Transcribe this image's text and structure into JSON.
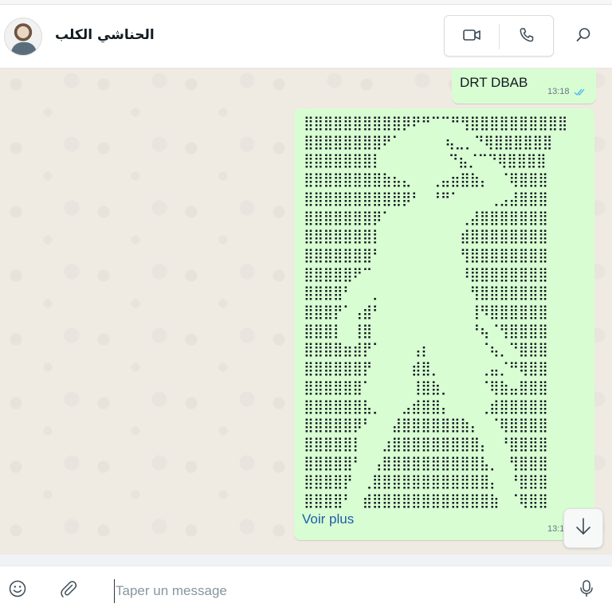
{
  "header": {
    "contact_name": "الحناشي الكلب",
    "video_call_icon": "video-camera-icon",
    "voice_call_icon": "phone-icon",
    "search_icon": "search-icon"
  },
  "messages": [
    {
      "text": "DRT DBAB",
      "time": "13:18",
      "status_icon": "double-check-read-icon"
    },
    {
      "ascii_art": "⣿⣿⣿⣿⣿⣿⣿⣿⣿⣿⡿⠟⠛⠉⠉⠛⢻⣿⣿⣿⣿⣿⣿⣿⣿⣿⣿\n⣿⣿⣿⣿⣿⣿⣿⣿⠟⠁  ⠀⠀ ⢦⣀⡀⠙⢿⣿⣿⣿⣿⣿⣿\n⣿⣿⣿⣿⣿⣿⣿⡇⠀⠀⠀⠀⠀ ⠀⠙⣦⡈⠉⠙⢿⣿⣿⣿⣿\n⣿⣿⣿⣿⣿⣿⣿⣿⣷⣦⣄⠀⠀⢀⣤⣶⣿⣷⡄⠀⠈⢿⣿⣿⣿\n⣿⣿⣿⣿⣿⣿⣿⣿⣿⣿⡿⠃⠀⠘⠛⠁⠀⠀⠀⢀⣠⣼⣿⣿⣿\n⣿⣿⣿⣿⣿⣿⣿⡿⠁⠀⠀⠀⠀⠀⠀⠀⢀⣼⣿⣿⣿⣿⣿⣿⣿\n⣿⣿⣿⣿⣿⣿⣿⡇⠀⠀⠀⠀⠀⠀⠀⠀⣾⣿⣿⣿⣿⣿⣿⣿⣿\n⣿⣿⣿⣿⣿⣿⣿⠃⠀⠀⠀⠀⠀⠀⠀⠀⢻⣿⣿⣿⣿⣿⣿⣿⣿\n⣿⣿⣿⣿⣿⠟⠉⠀⠀⠀⠀⠀⠀⠀⠀⠀⠸⣿⣿⣿⣿⣿⣿⣿⣿\n⣿⣿⣿⣿⠃⠀⠀⡀⠀⠀⠀⠀⠀⠀⠀⠀⠀⢻⣿⣿⣿⣿⣿⣿⣿\n⣿⣿⣿⡟⠁⢠⣾⠃⠀⠀⠀⠀⠀⠀⠀⠀⠀⢸⠻⣿⣿⣿⣿⣿⣿\n⣿⣿⣿⡇⠀⢸⣿⠀⠀⠀⠀⠀⠀⠀⠀⠀⠀⠘⢦⠈⢻⣿⣿⣿⣿\n⣿⣿⣿⣿⣶⣾⡟⠁⠀⠀⠀⢠⡆⠀⠀⠀⠀⠀⠈⢦⡀⠙⣿⣿⣿\n⣿⣿⣿⣿⣿⣿⡟⠀⠀⠀⠀⣾⣿⡀⠀⠀⠀⠀⢀⣤⡈⠛⢿⣿⣿\n⣿⣿⣿⣿⣿⣿⠁⠀⠀⠀⠀⢸⣿⣷⡀⠀⠀⠀⠈⢿⣷⣤⣿⣿⣿\n⣿⣿⣿⣿⣿⣿⣧⡀⠀⠀⣠⣾⣿⣿⡄⠀⠀⠀⢀⣾⣿⣿⣿⣿⣿\n⣿⣿⣿⣿⣿⡿⠃⠀⠀⣼⣿⣿⣿⣿⣿⣿⣷⡄⠀⠈⢿⣿⣿⣿⣿\n⣿⣿⣿⣿⣿⡇⠀⠀⣰⣿⣿⣿⣿⣿⣿⣿⣿⣿⡄⠀⠘⣿⣿⣿⣿\n⣿⣿⣿⣿⣿⠃⠀⢠⣿⣿⣿⣿⣿⣿⣿⣿⣿⣿⣧⡀⠀⢻⣿⣿⣿\n⣿⣿⣿⣿⡟⠀⢀⣿⣿⣿⣿⣿⣿⣿⣿⣿⣿⣿⣿⡄⠀⠘⣿⣿⣿\n⣿⣿⣿⣿⠃⠀⣾⣿⣿⣿⣿⣿⣿⣿⣿⣿⣿⣿⣿⣷⠀⠈⢿⣿⣿",
      "more_label": "Voir plus",
      "time": "13:1"
    }
  ],
  "scroll_icon": "arrow-down-icon",
  "composer": {
    "placeholder": "Taper un message",
    "value": "",
    "emoji_icon": "smiley-icon",
    "attach_icon": "paperclip-icon",
    "mic_icon": "microphone-icon"
  },
  "colors": {
    "outgoing_bubble": "#d9fdd3",
    "chat_background": "#efeae2",
    "link": "#1b5ea7",
    "read_ticks": "#53bdeb"
  }
}
